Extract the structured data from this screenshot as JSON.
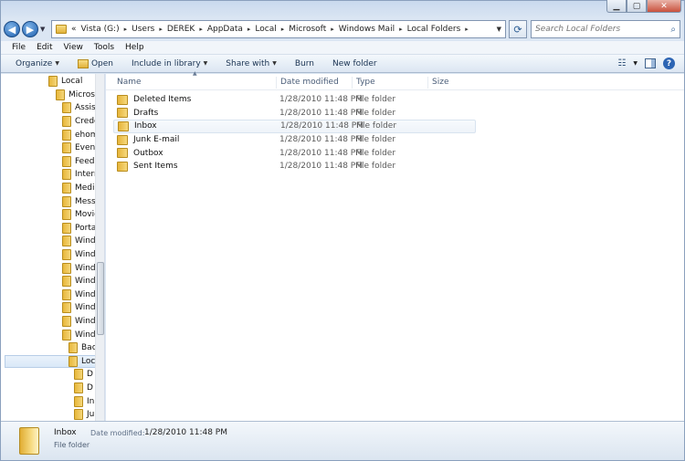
{
  "address": {
    "crumbs": [
      "«",
      "Vista (G:)",
      "Users",
      "DEREK",
      "AppData",
      "Local",
      "Microsoft",
      "Windows Mail",
      "Local Folders"
    ]
  },
  "search": {
    "placeholder": "Search Local Folders"
  },
  "menu": [
    "File",
    "Edit",
    "View",
    "Tools",
    "Help"
  ],
  "commands": {
    "organize": "Organize",
    "open": "Open",
    "include": "Include in library",
    "share": "Share with",
    "burn": "Burn",
    "new_folder": "New folder"
  },
  "nav_tree": [
    {
      "label": "Local",
      "indent": 0
    },
    {
      "label": "Microso",
      "indent": 1
    },
    {
      "label": "Assist",
      "indent": 2
    },
    {
      "label": "Crede",
      "indent": 2
    },
    {
      "label": "ehom",
      "indent": 2
    },
    {
      "label": "Event",
      "indent": 2
    },
    {
      "label": "Feeds",
      "indent": 2
    },
    {
      "label": "Interr",
      "indent": 2
    },
    {
      "label": "Media",
      "indent": 2
    },
    {
      "label": "Messe",
      "indent": 2
    },
    {
      "label": "Movie",
      "indent": 2
    },
    {
      "label": "Porta",
      "indent": 2
    },
    {
      "label": "Wind",
      "indent": 2
    },
    {
      "label": "Wind",
      "indent": 2
    },
    {
      "label": "Wind",
      "indent": 2
    },
    {
      "label": "Wind",
      "indent": 2
    },
    {
      "label": "Wind",
      "indent": 2
    },
    {
      "label": "Wind",
      "indent": 2
    },
    {
      "label": "Wind",
      "indent": 2
    },
    {
      "label": "Wind",
      "indent": 2
    },
    {
      "label": "Bac",
      "indent": 3
    },
    {
      "label": "Loc",
      "indent": 3,
      "selected": true
    },
    {
      "label": "D",
      "indent": 4
    },
    {
      "label": "D",
      "indent": 4
    },
    {
      "label": "In",
      "indent": 4
    },
    {
      "label": "Ju",
      "indent": 4
    }
  ],
  "columns": {
    "name": "Name",
    "date": "Date modified",
    "type": "Type",
    "size": "Size"
  },
  "files": [
    {
      "name": "Deleted Items",
      "date": "1/28/2010 11:48 PM",
      "type": "File folder"
    },
    {
      "name": "Drafts",
      "date": "1/28/2010 11:48 PM",
      "type": "File folder"
    },
    {
      "name": "Inbox",
      "date": "1/28/2010 11:48 PM",
      "type": "File folder"
    },
    {
      "name": "Junk E-mail",
      "date": "1/28/2010 11:48 PM",
      "type": "File folder"
    },
    {
      "name": "Outbox",
      "date": "1/28/2010 11:48 PM",
      "type": "File folder"
    },
    {
      "name": "Sent Items",
      "date": "1/28/2010 11:48 PM",
      "type": "File folder"
    }
  ],
  "details": {
    "name": "Inbox",
    "modified_label": "Date modified:",
    "modified_value": "1/28/2010 11:48 PM",
    "type": "File folder"
  }
}
